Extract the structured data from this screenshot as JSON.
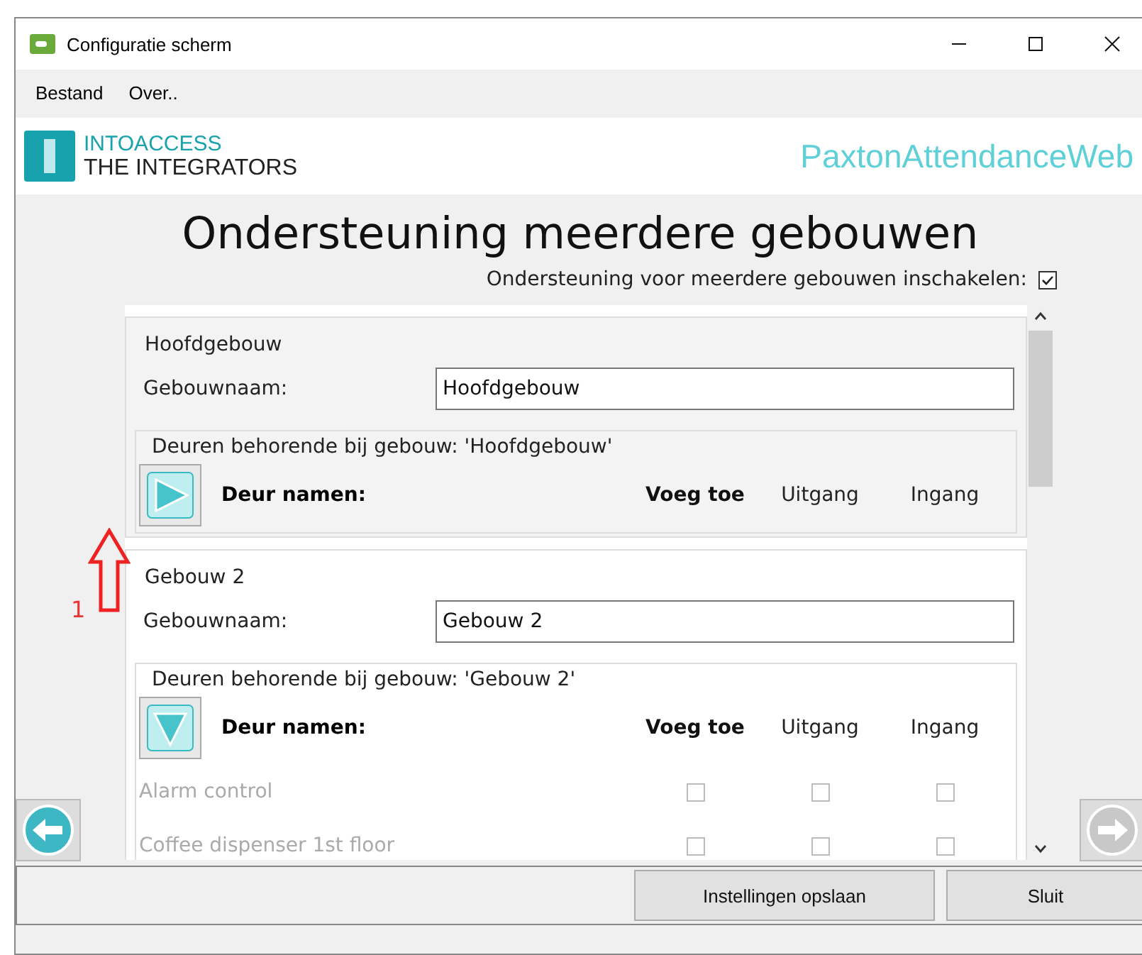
{
  "window": {
    "title": "Configuratie scherm"
  },
  "menu": [
    "Bestand",
    "Over.."
  ],
  "logo": {
    "line1": "INTOACCESS",
    "line2": "THE INTEGRATORS"
  },
  "app_name": "PaxtonAttendanceWeb",
  "page_title": "Ondersteuning meerdere gebouwen",
  "multi_building": {
    "label": "Ondersteuning voor meerdere gebouwen inschakelen:",
    "checked": true
  },
  "buildings": [
    {
      "title": "Hoofdgebouw",
      "name_label": "Gebouwnaam:",
      "name_value": "Hoofdgebouw",
      "doors_title": "Deuren behorende bij gebouw: 'Hoofdgebouw'",
      "expanded": false,
      "selected": false,
      "columns": [
        "Deur namen:",
        "Voeg toe",
        "Uitgang",
        "Ingang"
      ]
    },
    {
      "title": "Gebouw 2",
      "name_label": "Gebouwnaam:",
      "name_value": "Gebouw 2",
      "doors_title": "Deuren behorende bij gebouw: 'Gebouw 2'",
      "expanded": true,
      "selected": true,
      "columns": [
        "Deur namen:",
        "Voeg toe",
        "Uitgang",
        "Ingang"
      ],
      "doors": [
        {
          "name": "Alarm control",
          "disabled": true,
          "add": false,
          "exit": false,
          "entry": false
        },
        {
          "name": "Coffee dispenser 1st floor",
          "disabled": true,
          "add": false,
          "exit": false,
          "entry": false
        }
      ]
    }
  ],
  "nav": {
    "back_disabled": false,
    "forward_disabled": true
  },
  "buttons": [
    "Instellingen opslaan",
    "Sluit"
  ],
  "annotation": {
    "label": "1"
  }
}
